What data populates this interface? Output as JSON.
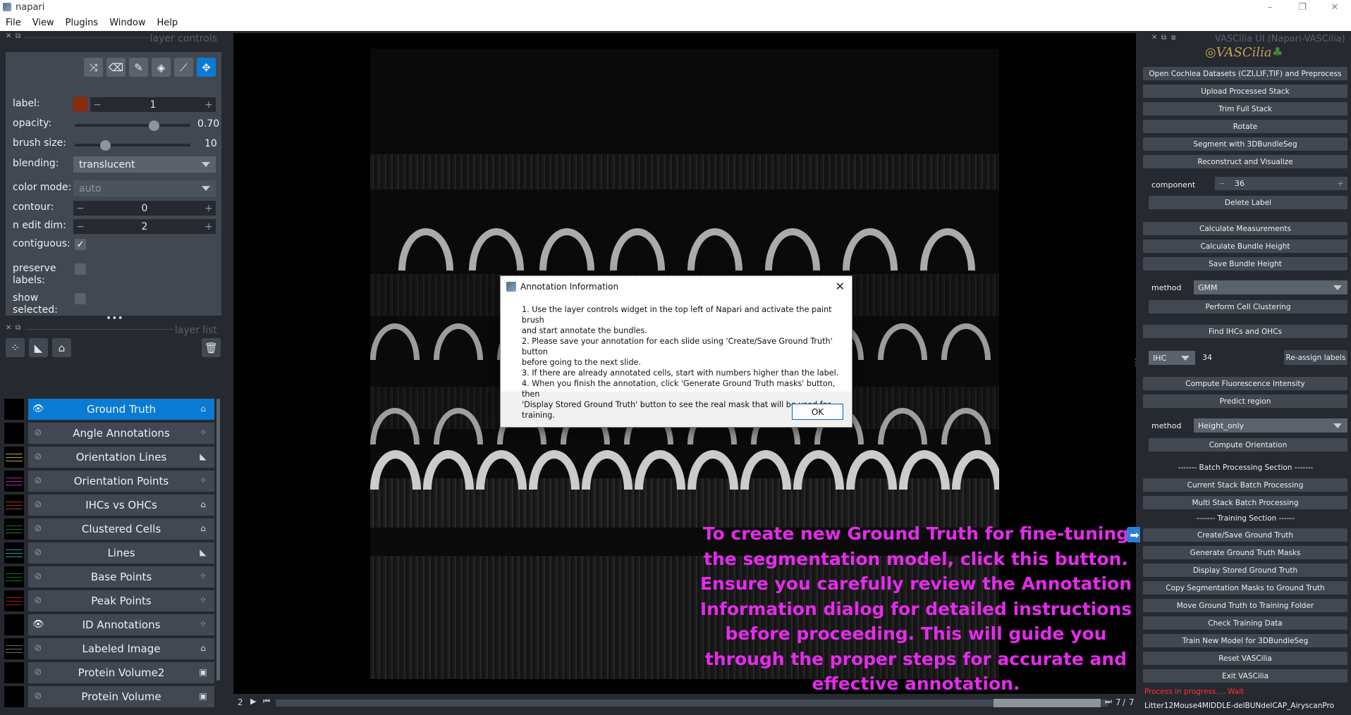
{
  "window": {
    "title": "napari",
    "minimize": "–",
    "maximize": "❐",
    "close": "✕"
  },
  "menu": [
    "File",
    "View",
    "Plugins",
    "Window",
    "Help"
  ],
  "layer_controls": {
    "header": "layer controls",
    "label_label": "label:",
    "label_value": "1",
    "label_color": "#8b2a0c",
    "opacity_label": "opacity:",
    "opacity_value": "0.70",
    "opacity_fraction": 0.7,
    "brush_label": "brush size:",
    "brush_value": "10",
    "blending_label": "blending:",
    "blending_value": "translucent",
    "colormode_label": "color mode:",
    "colormode_value": "auto",
    "contour_label": "contour:",
    "contour_value": "0",
    "nedit_label": "n edit dim:",
    "nedit_value": "2",
    "contiguous_label": "contiguous:",
    "preserve_label1": "preserve",
    "preserve_label2": "labels:",
    "show_label1": "show",
    "show_label2": "selected:",
    "minus": "−",
    "plus": "+",
    "check": "✓"
  },
  "layer_list": {
    "header": "layer list",
    "layers": [
      {
        "name": "Ground Truth",
        "visible": true,
        "selected": true,
        "type_icon": "label-icon"
      },
      {
        "name": "Angle Annotations",
        "visible": false,
        "type_icon": "points-icon"
      },
      {
        "name": "Orientation Lines",
        "visible": false,
        "type_icon": "shapes-icon"
      },
      {
        "name": "Orientation Points",
        "visible": false,
        "type_icon": "points-icon"
      },
      {
        "name": "IHCs vs OHCs",
        "visible": false,
        "type_icon": "label-icon"
      },
      {
        "name": "Clustered Cells",
        "visible": false,
        "type_icon": "label-icon"
      },
      {
        "name": "Lines",
        "visible": false,
        "type_icon": "shapes-icon"
      },
      {
        "name": "Base Points",
        "visible": false,
        "type_icon": "points-icon"
      },
      {
        "name": "Peak Points",
        "visible": false,
        "type_icon": "points-icon"
      },
      {
        "name": "ID Annotations",
        "visible": true,
        "type_icon": "points-icon"
      },
      {
        "name": "Labeled Image",
        "visible": false,
        "type_icon": "label-icon"
      },
      {
        "name": "Protein Volume2",
        "visible": false,
        "type_icon": "image-icon"
      },
      {
        "name": "Protein Volume",
        "visible": false,
        "type_icon": "image-icon"
      }
    ]
  },
  "dialog": {
    "title": "Annotation Information",
    "lines": [
      "1. Use the layer controls widget in the top left of Napari and activate the paint brush",
      "and start annotate the bundles.",
      "2. Please save your annotation for each slide using 'Create/Save Ground Truth' button",
      "before going to the next slide.",
      "3. If there are already annotated cells, start with numbers higher than the label.",
      "4. When you finish the annotation, click  'Generate Ground Truth masks' button, then",
      "'Display Stored Ground Truth' button to see the real mask that will be used for training."
    ],
    "ok": "OK"
  },
  "note": "To create new Ground Truth for fine-tuning the segmentation model, click this button. Ensure you carefully review the Annotation Information dialog for detailed instructions before proceeding. This will guide you through the proper steps for accurate and effective annotation.",
  "dims": {
    "index": "2",
    "current": "7",
    "total": "7"
  },
  "vascilia": {
    "title": "VASCilia UI (Napari-VASCilia)",
    "logo": "VASCilia",
    "buttons_top": [
      "Open Cochlea Datasets (CZI,LIF,TIF) and Preprocess",
      "Upload Processed Stack",
      "Trim Full Stack",
      "Rotate",
      "Segment with 3DBundleSeg",
      "Reconstruct and Visualize"
    ],
    "component_label": "component",
    "component_value": "36",
    "delete_label": "Delete Label",
    "buttons_mid": [
      "Calculate Measurements",
      "Calculate Bundle Height",
      "Save Bundle Height"
    ],
    "method_label": "method",
    "method1_value": "GMM",
    "cluster": "Perform Cell Clustering",
    "find_ihc": "Find IHCs and OHCs",
    "ihc_value": "IHC",
    "ihc_number": "34",
    "reassign": "Re-assign labels",
    "fluor": "Compute Fluorescence Intensity",
    "predict": "Predict region",
    "method2_value": "Height_only",
    "orientation": "Compute Orientation",
    "batch_section": "------- Batch Processing Section -------",
    "batch_buttons": [
      "Current Stack Batch Processing",
      "Multi Stack Batch Processing"
    ],
    "training_section": "------- Training Section ------",
    "training_buttons": [
      "Create/Save Ground Truth",
      "Generate Ground Truth Masks",
      "Display Stored Ground Truth",
      "Copy Segmentation Masks to Ground Truth",
      "Move Ground Truth to Training Folder",
      "Check Training Data",
      "Train New Model for 3DBundleSeg",
      "Reset VASCilia",
      "Exit VASCilia"
    ],
    "status": "Process in progress..., Wait",
    "file": "Litter12Mouse4MIDDLE-delBUNdelCAP_AiryscanPro"
  }
}
